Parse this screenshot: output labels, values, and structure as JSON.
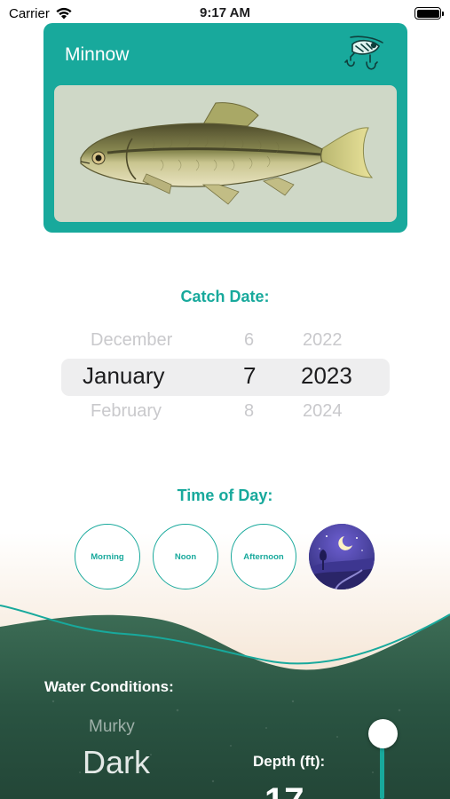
{
  "status_bar": {
    "carrier": "Carrier",
    "time": "9:17 AM",
    "wifi_icon": "wifi-icon",
    "battery_icon": "battery-icon"
  },
  "fish_card": {
    "name": "Minnow",
    "lure_icon": "fishing-lure-icon",
    "image": "minnow-fish-illustration",
    "card_color": "#18a99c"
  },
  "catch_date": {
    "title": "Catch Date:",
    "prev": {
      "month": "December",
      "day": "6",
      "year": "2022"
    },
    "current": {
      "month": "January",
      "day": "7",
      "year": "2023"
    },
    "next": {
      "month": "February",
      "day": "8",
      "year": "2024"
    }
  },
  "time_of_day": {
    "title": "Time of Day:",
    "options": [
      "Morning",
      "Noon",
      "Afternoon"
    ],
    "selected_icon": "night-moon-icon"
  },
  "water": {
    "title": "Water Conditions:",
    "wheel_prev": "Murky",
    "wheel_current": "Dark",
    "depth_label": "Depth (ft):",
    "depth_value": "17"
  },
  "colors": {
    "accent": "#18a99c",
    "water_dark": "#2c5a46",
    "sand": "#f5e6d6"
  }
}
